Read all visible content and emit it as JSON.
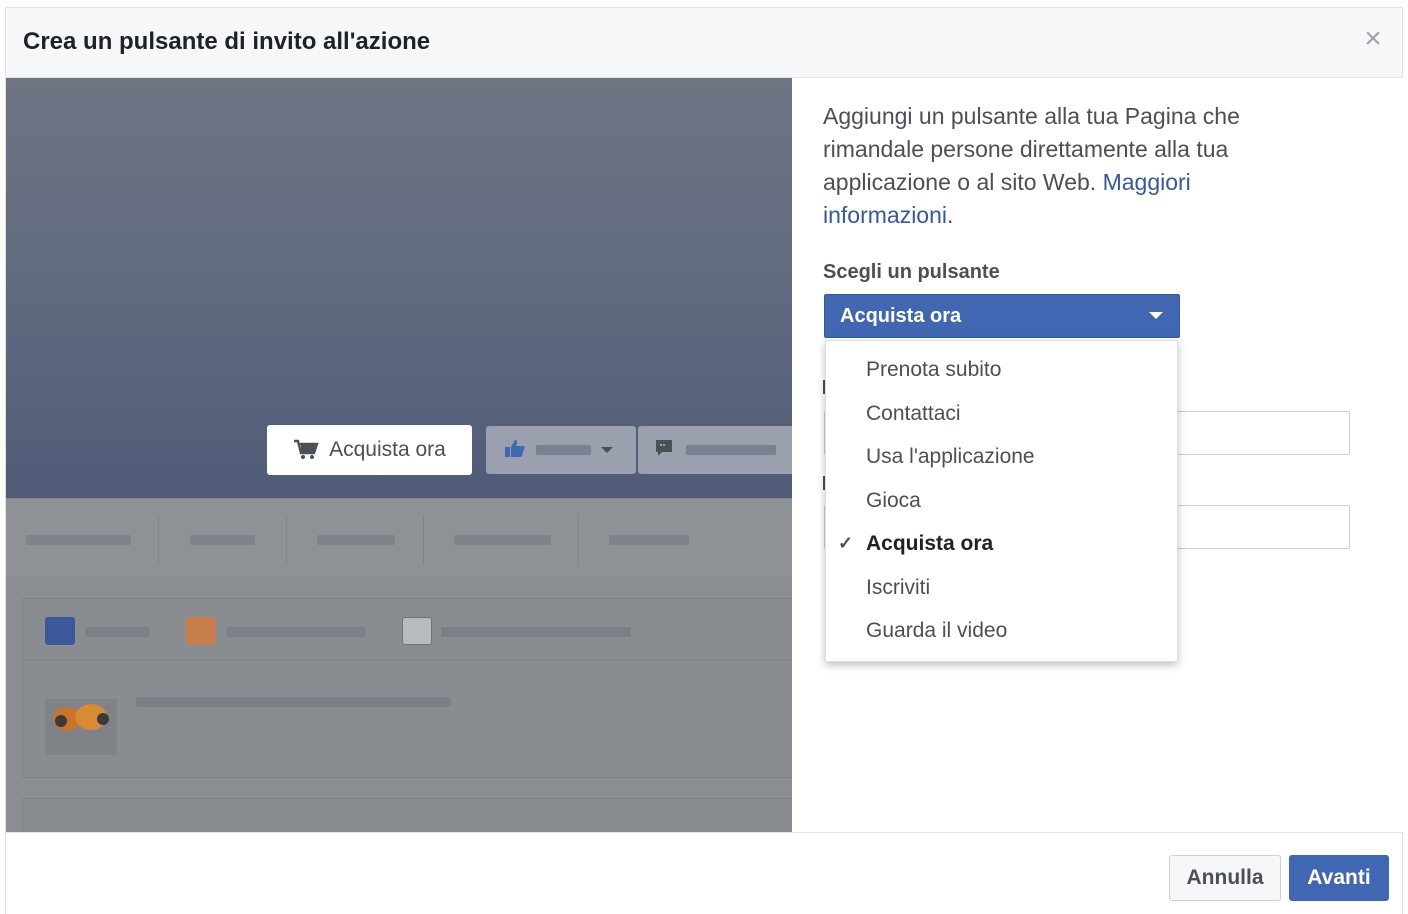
{
  "dialog": {
    "title": "Crea un pulsante di invito all'azione",
    "close_icon": "close-icon"
  },
  "preview": {
    "cta_label": "Acquista ora",
    "cta_icon": "cart-icon",
    "like_icon": "thumbs-up-icon",
    "message_icon": "speech-bubble-icon"
  },
  "form": {
    "description_text": "Aggiungi un pulsante alla tua Pagina che rimandale persone direttamente alla tua applicazione o al sito Web. ",
    "learn_more_link": "Maggiori informazioni",
    "description_end": ".",
    "choose_label": "Scegli un pulsante",
    "selected_value": "Acquista ora",
    "options": [
      {
        "label": "Prenota subito",
        "selected": false
      },
      {
        "label": "Contattaci",
        "selected": false
      },
      {
        "label": "Usa l'applicazione",
        "selected": false
      },
      {
        "label": "Gioca",
        "selected": false
      },
      {
        "label": "Acquista ora",
        "selected": true
      },
      {
        "label": "Iscriviti",
        "selected": false
      },
      {
        "label": "Guarda il video",
        "selected": false
      }
    ]
  },
  "footer": {
    "cancel_label": "Annulla",
    "next_label": "Avanti"
  },
  "colors": {
    "accent": "#4267b2",
    "link": "#365899",
    "header_bg": "#f6f7f9"
  }
}
